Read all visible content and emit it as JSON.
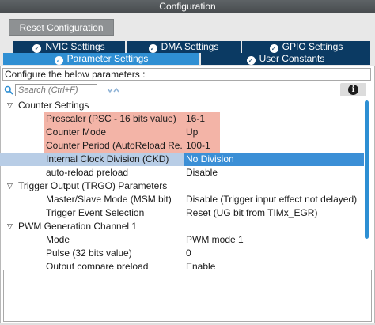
{
  "window": {
    "title": "Configuration"
  },
  "toolbar": {
    "reset_label": "Reset Configuration"
  },
  "tabs": {
    "row1": [
      {
        "label": "NVIC Settings",
        "active": false
      },
      {
        "label": "DMA Settings",
        "active": false
      },
      {
        "label": "GPIO Settings",
        "active": false
      }
    ],
    "row2": [
      {
        "label": "Parameter Settings",
        "active": true
      },
      {
        "label": "User Constants",
        "active": false
      }
    ]
  },
  "config_label": "Configure the below parameters :",
  "search": {
    "placeholder": "Search (Ctrl+F)"
  },
  "tree": {
    "groups": [
      {
        "label": "Counter Settings",
        "params": [
          {
            "name": "Prescaler (PSC - 16 bits value)",
            "value": "16-1",
            "highlighted": true
          },
          {
            "name": "Counter Mode",
            "value": "Up",
            "highlighted": true
          },
          {
            "name": "Counter Period (AutoReload Re...",
            "value": "100-1",
            "highlighted": true
          },
          {
            "name": "Internal Clock Division (CKD)",
            "value": "No Division",
            "selected": true
          },
          {
            "name": "auto-reload preload",
            "value": "Disable"
          }
        ]
      },
      {
        "label": "Trigger Output (TRGO) Parameters",
        "params": [
          {
            "name": "Master/Slave Mode (MSM bit)",
            "value": "Disable (Trigger input effect not delayed)"
          },
          {
            "name": "Trigger Event Selection",
            "value": "Reset (UG bit from TIMx_EGR)"
          }
        ]
      },
      {
        "label": "PWM Generation Channel 1",
        "params": [
          {
            "name": "Mode",
            "value": "PWM mode 1"
          },
          {
            "name": "Pulse (32 bits value)",
            "value": "0"
          },
          {
            "name": "Output compare preload",
            "value": "Enable"
          }
        ]
      }
    ]
  },
  "colors": {
    "titlebar": "#4f5356",
    "tab_inactive": "#0b3a63",
    "tab_active": "#2f8fd3",
    "highlight": "#f3b4a7",
    "selected_row": "#b8cde6",
    "selected_value": "#3b8fd6"
  }
}
